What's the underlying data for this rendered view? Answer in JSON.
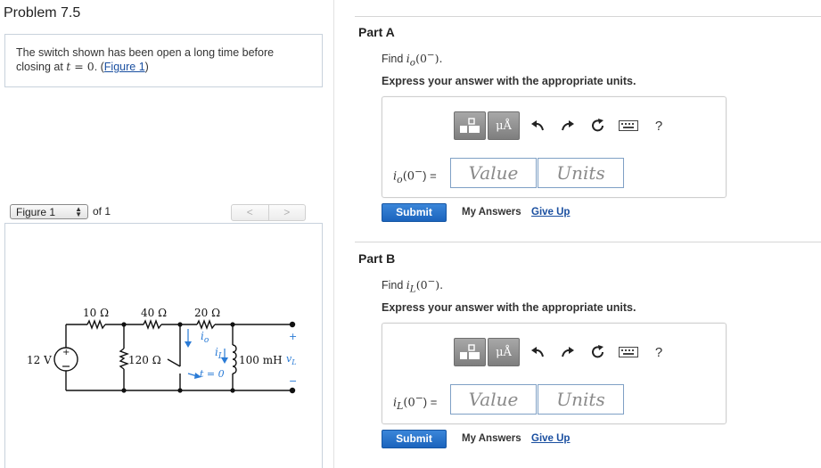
{
  "problem": {
    "title": "Problem 7.5",
    "text_before": "The switch shown has been open a long time before closing at ",
    "math_var": "t",
    "math_eq": " = 0",
    "text_after": ". (",
    "figure_link": "Figure 1",
    "text_end": ")"
  },
  "figure_nav": {
    "selected": "Figure 1",
    "of_text": "of 1",
    "prev_icon": "chevron-left-icon",
    "next_icon": "chevron-right-icon"
  },
  "circuit": {
    "source": "12 V",
    "r1": "10 Ω",
    "r2": "40 Ω",
    "r3": "20 Ω",
    "r4": "120 Ω",
    "inductor": "100 mH",
    "vL": "v",
    "vL_sub": "L",
    "io": "i",
    "io_sub": "o",
    "iL": "i",
    "iL_sub": "L",
    "switch_label": "t = 0",
    "plus": "+",
    "minus": "−"
  },
  "parts": [
    {
      "title": "Part A",
      "find_prefix": "Find ",
      "find_var": "i",
      "find_sub": "o",
      "find_arg": "(0",
      "find_sup": "−",
      "find_close": ").",
      "express": "Express your answer with the appropriate units.",
      "label_var": "i",
      "label_sub": "o",
      "label_arg": "(0",
      "label_sup": "−",
      "label_close": ") =",
      "value_placeholder": "Value",
      "units_placeholder": "Units",
      "submit": "Submit",
      "my_answers": "My Answers",
      "give_up": "Give Up"
    },
    {
      "title": "Part B",
      "find_prefix": "Find ",
      "find_var": "i",
      "find_sub": "L",
      "find_arg": "(0",
      "find_sup": "−",
      "find_close": ").",
      "express": "Express your answer with the appropriate units.",
      "label_var": "i",
      "label_sub": "L",
      "label_arg": "(0",
      "label_sup": "−",
      "label_close": ") =",
      "value_placeholder": "Value",
      "units_placeholder": "Units",
      "submit": "Submit",
      "my_answers": "My Answers",
      "give_up": "Give Up"
    }
  ],
  "toolbar": {
    "mu_label": "μÅ",
    "help_label": "?",
    "icons": [
      "templates-icon",
      "units-icon",
      "undo-icon",
      "redo-icon",
      "reset-icon",
      "keyboard-icon",
      "help-icon"
    ]
  },
  "colors": {
    "accent": "#1b64bd",
    "link": "#1a4fa0",
    "circuit_blue": "#2a7bd6",
    "border": "#c8d2dc"
  }
}
